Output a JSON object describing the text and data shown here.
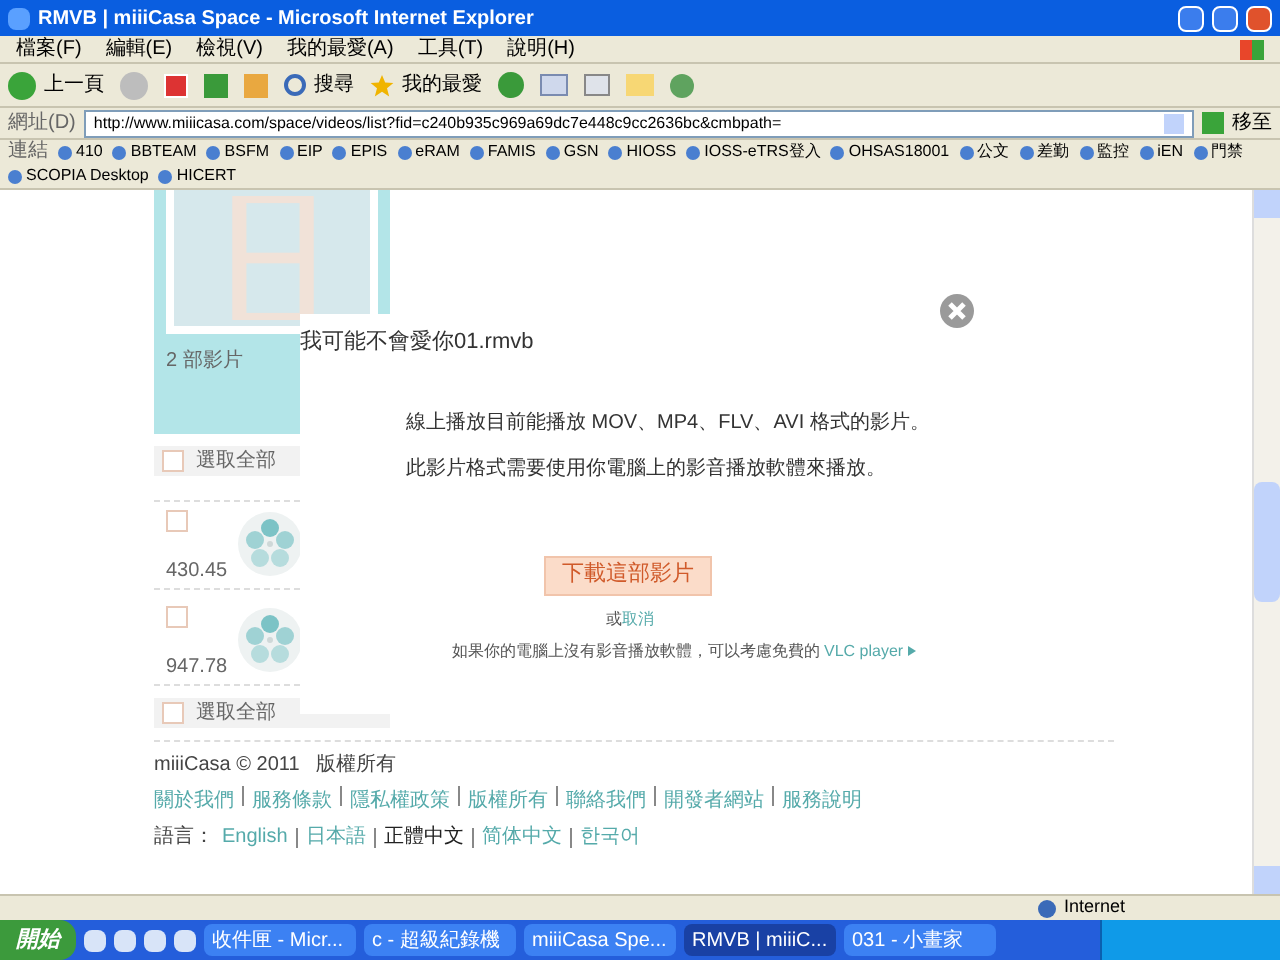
{
  "window": {
    "title": "RMVB | miiiCasa Space - Microsoft Internet Explorer"
  },
  "menu": [
    "檔案(F)",
    "編輯(E)",
    "檢視(V)",
    "我的最愛(A)",
    "工具(T)",
    "說明(H)"
  ],
  "toolbar": {
    "back": "上一頁",
    "search": "搜尋",
    "favorites": "我的最愛"
  },
  "address": {
    "label": "網址(D)",
    "url": "http://www.miiicasa.com/space/videos/list?fid=c240b935c969a69dc7e448c9cc2636bc&cmbpath=",
    "go": "移至"
  },
  "links": {
    "label": "連結",
    "items": [
      "410",
      "BBTEAM",
      "BSFM",
      "EIP",
      "EPIS",
      "eRAM",
      "FAMIS",
      "GSN",
      "HIOSS",
      "IOSS-eTRS登入",
      "OHSAS18001",
      "公文",
      "差勤",
      "監控",
      "iEN",
      "門禁",
      "SCOPIA Desktop",
      "HICERT"
    ]
  },
  "sidebar": {
    "album_count": "2 部影片",
    "select_all_top": {
      "label": "選取全部",
      "checked": false
    },
    "videos": [
      {
        "size": "430.45",
        "checked": false
      },
      {
        "size": "947.78",
        "checked": false
      }
    ],
    "select_all_bottom": {
      "label": "選取全部",
      "checked": false
    }
  },
  "dialog": {
    "title": "我可能不會愛你01.rmvb",
    "lines": [
      "線上播放目前能播放 MOV、MP4、FLV、AVI 格式的影片。",
      "此影片格式需要使用你電腦上的影音播放軟體來播放。"
    ],
    "download_button": "下載這部影片",
    "cancel_prefix": "或",
    "cancel_link": "取消",
    "hint": "如果你的電腦上沒有影音播放軟體，可以考慮免費的",
    "hint_link": "VLC player"
  },
  "footer": {
    "copyright": "miiiCasa © 2011",
    "rights": "版權所有",
    "links": [
      "關於我們",
      "服務條款",
      "隱私權政策",
      "版權所有",
      "聯絡我們",
      "開發者網站",
      "服務說明"
    ],
    "language_label": "語言：",
    "languages": [
      {
        "label": "English",
        "selected": false
      },
      {
        "label": "日本語",
        "selected": false
      },
      {
        "label": "正體中文",
        "selected": true
      },
      {
        "label": "简体中文",
        "selected": false
      },
      {
        "label": "한국어",
        "selected": false
      }
    ]
  },
  "status_bar": {
    "zone": "Internet"
  },
  "taskbar": {
    "start": "開始",
    "tasks": [
      {
        "label": "收件匣 - Micr...",
        "selected": false
      },
      {
        "label": "c - 超級紀錄機",
        "selected": false
      },
      {
        "label": "miiiCasa Spe...",
        "selected": false
      },
      {
        "label": "RMVB | miiiC...",
        "selected": true
      },
      {
        "label": "031 - 小畫家",
        "selected": false
      }
    ]
  }
}
